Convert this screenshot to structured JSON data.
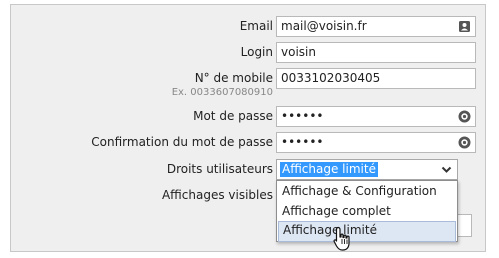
{
  "form": {
    "email": {
      "label": "Email",
      "value": "mail@voisin.fr",
      "icon": "contact-card-icon"
    },
    "login": {
      "label": "Login",
      "value": "voisin"
    },
    "mobile": {
      "label": "N° de mobile",
      "hint": "Ex. 0033607080910",
      "value": "0033102030405"
    },
    "password": {
      "label": "Mot de passe",
      "value": "••••••",
      "icon": "reveal-password-icon"
    },
    "password_confirm": {
      "label": "Confirmation du mot de passe",
      "value": "••••••",
      "icon": "reveal-password-icon"
    },
    "rights": {
      "label": "Droits utilisateurs",
      "selected": "Affichage limité",
      "options": [
        "Affichage & Configuration",
        "Affichage complet",
        "Affichage limité"
      ],
      "hovered_index": 2
    },
    "visible_displays": {
      "label": "Affichages visibles"
    }
  },
  "colors": {
    "selection": "#3399ff",
    "hover": "#dde6f3",
    "panel": "#efefef"
  }
}
